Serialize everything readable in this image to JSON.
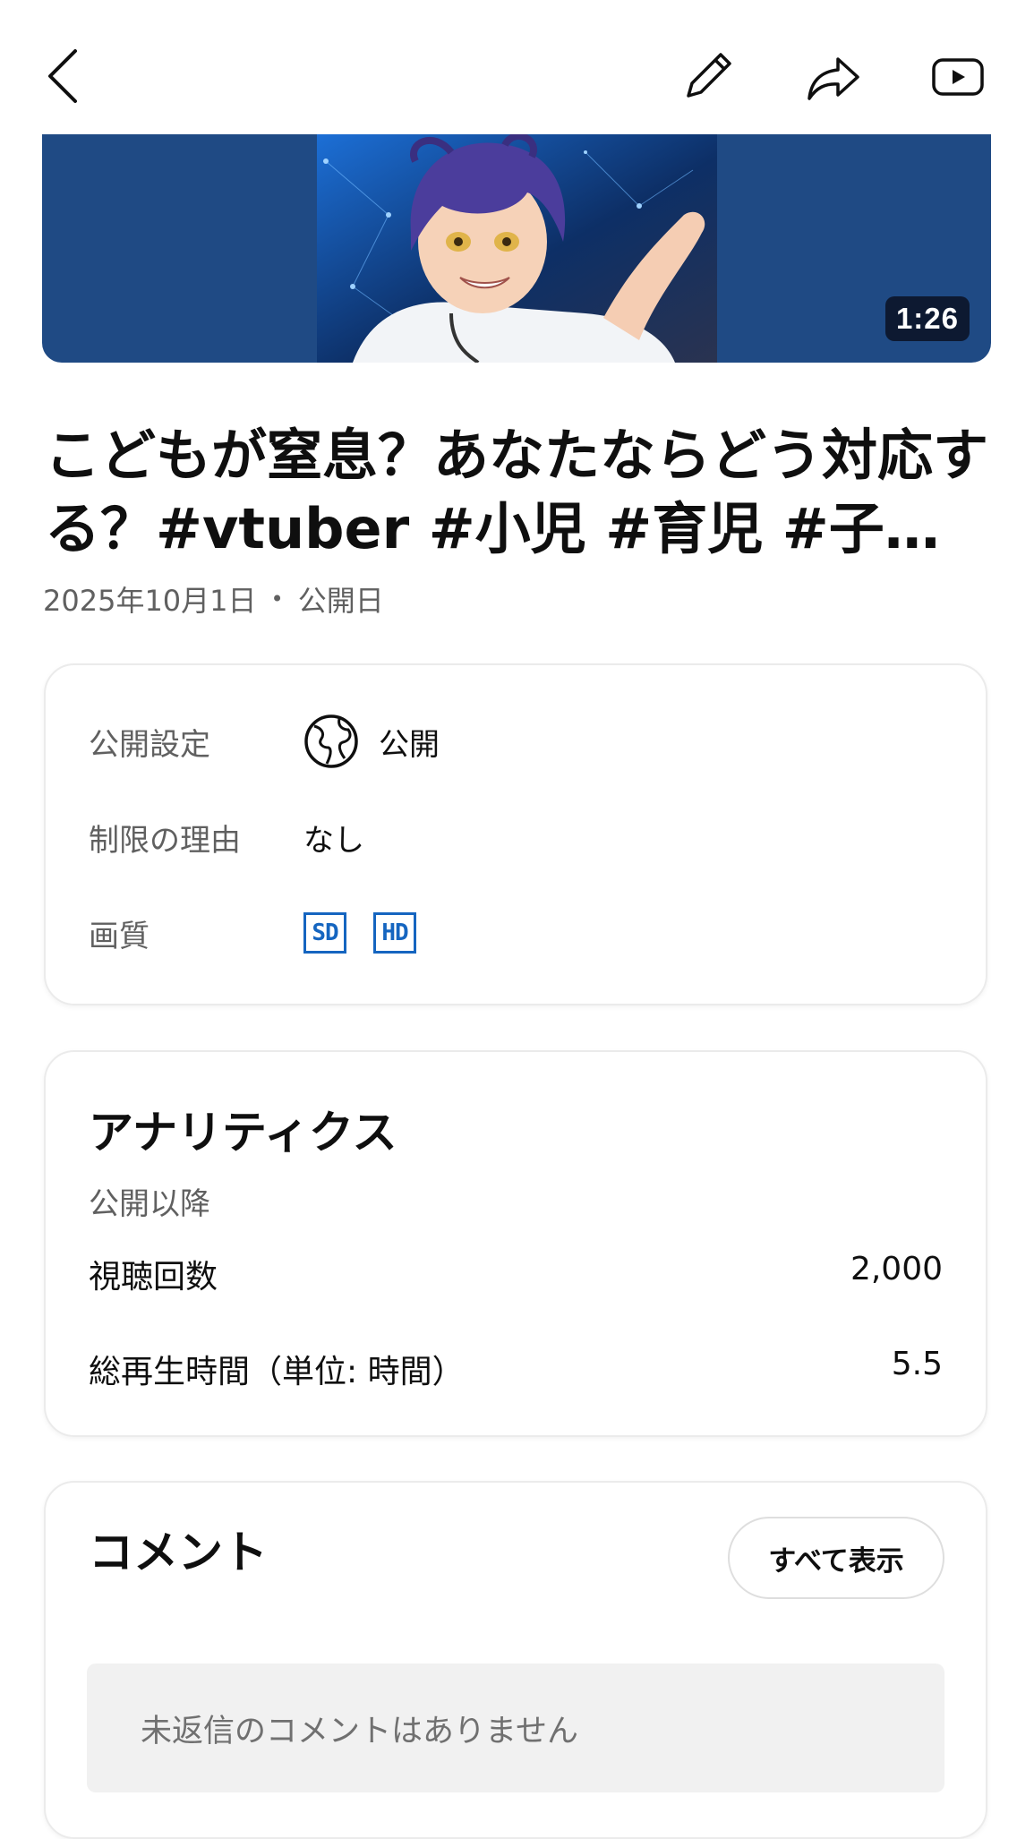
{
  "icons": {
    "back": "chevron-left-icon",
    "edit": "pencil-icon",
    "share": "share-icon",
    "youtube": "play-icon",
    "globe": "globe-icon"
  },
  "video": {
    "duration": "1:26",
    "title": "こどもが窒息？あなたならどう対応する？#vtuber #小児 #育児 #子…",
    "date": "2025年10月1日",
    "date_suffix": "公開日"
  },
  "details": {
    "visibility_label": "公開設定",
    "visibility_value": "公開",
    "restriction_label": "制限の理由",
    "restriction_value": "なし",
    "quality_label": "画質",
    "quality_badges": [
      "SD",
      "HD"
    ]
  },
  "analytics": {
    "title": "アナリティクス",
    "subtitle": "公開以降",
    "views_label": "視聴回数",
    "views_value": "2,000",
    "watch_label": "総再生時間（単位: 時間）",
    "watch_value": "5.5"
  },
  "comments": {
    "title": "コメント",
    "show_all": "すべて表示",
    "empty": "未返信のコメントはありません"
  },
  "colors": {
    "accent_blue": "#1565c0",
    "thumb_bg": "#1f4a84"
  }
}
